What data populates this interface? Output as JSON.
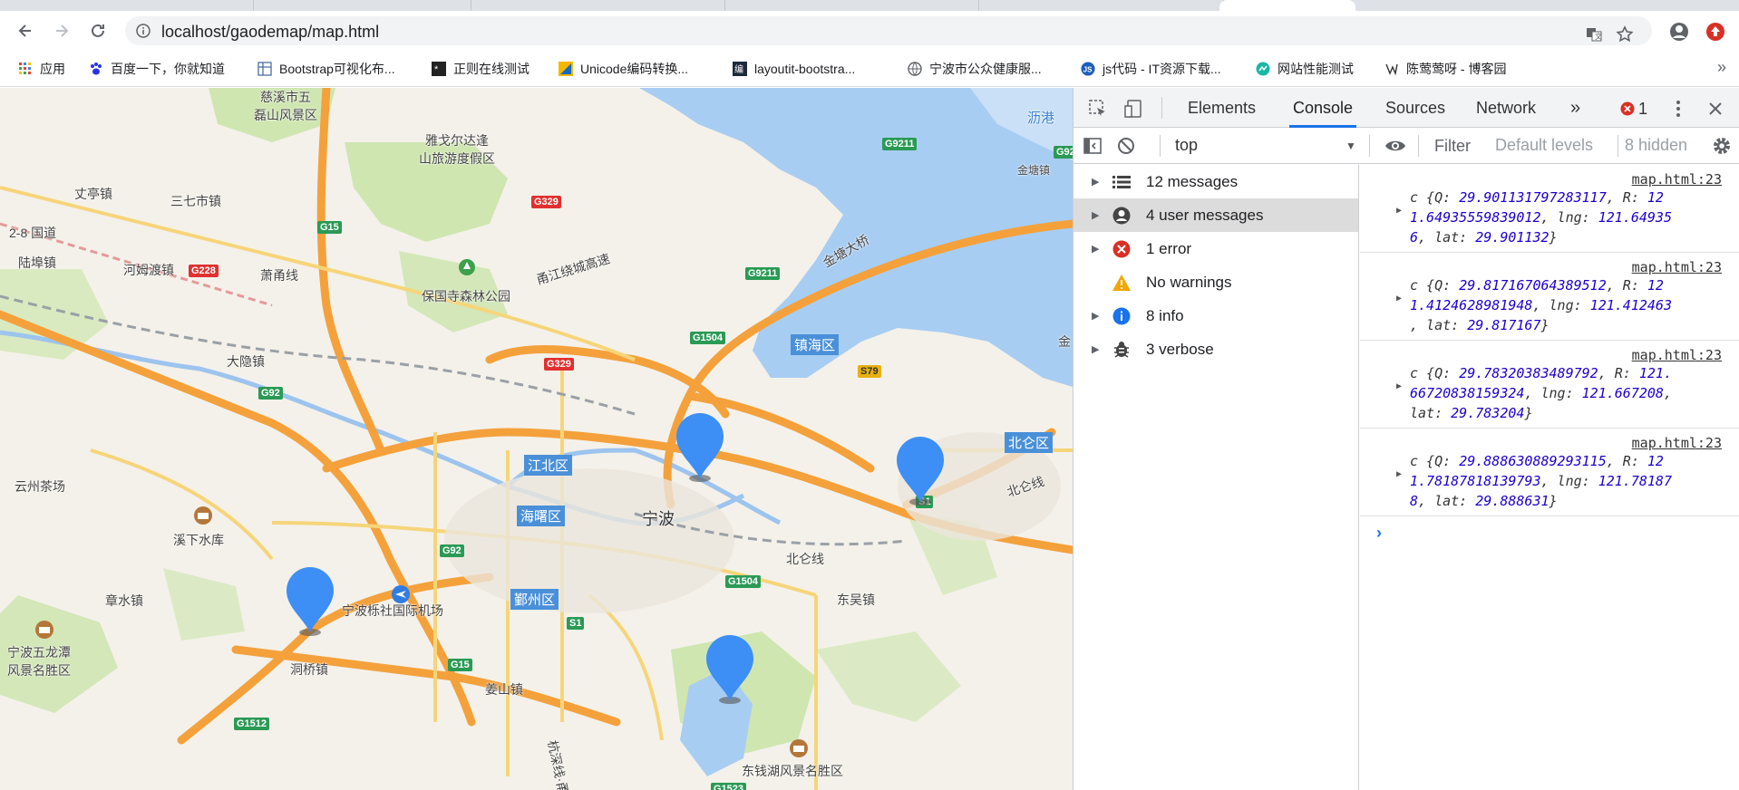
{
  "browser": {
    "url": "localhost/gaodemap/map.html",
    "bookmarks": [
      {
        "label": "应用",
        "icon": "apps-grid-icon"
      },
      {
        "label": "百度一下，你就知道",
        "icon": "baidu-paw-icon"
      },
      {
        "label": "Bootstrap可视化布...",
        "icon": "grid-layout-icon"
      },
      {
        "label": "正则在线测试",
        "icon": "regex-star-icon"
      },
      {
        "label": "Unicode编码转换...",
        "icon": "unicode-icon"
      },
      {
        "label": "layoutit-bootstra...",
        "icon": "editor-icon"
      },
      {
        "label": "宁波市公众健康服...",
        "icon": "globe-icon"
      },
      {
        "label": "js代码 - IT资源下载...",
        "icon": "js-icon"
      },
      {
        "label": "网站性能测试",
        "icon": "speed-icon"
      },
      {
        "label": "陈莺莺呀 - 博客园",
        "icon": "blog-icon"
      }
    ],
    "more_label": "»"
  },
  "map": {
    "places": {
      "cixi": "慈溪市五\n磊山风景区",
      "yage": "雅戈尔达逢\n山旅游度假区",
      "lixiang": "丈亭镇",
      "sanqi": "三七市镇",
      "g28": "2-8 国道",
      "luyu": "陆埠镇",
      "hemu": "河姆渡镇",
      "baoguo": "保国寺森林公园",
      "dayin": "大隐镇",
      "yunzhou": "云州茶场",
      "xixia": "溪下水库",
      "zhangshui": "章水镇",
      "wulong": "宁波五龙潭\n风景名胜区",
      "dongqiao": "洞桥镇",
      "jiangshan": "姜山镇",
      "dongwu": "东吴镇",
      "dongqian": "东钱湖风景名胜区",
      "ningbo": "宁波",
      "airport": "宁波栎社国际机场",
      "jintang": "金塘大桥",
      "jintangzhen": "金塘镇",
      "ligang": "沥港",
      "jin": "金",
      "yongjiang": "甬江绕城高速",
      "xiaoyong": "萧甬线",
      "beilunxian": "北仑线",
      "beilunxian2": "北仑线",
      "yongqian": "杭深线·甬"
    },
    "districts": {
      "jiangbei": "江北区",
      "haishu": "海曙区",
      "yinzhou": "鄞州区",
      "zhenhai": "镇海区",
      "beilun": "北仑区"
    },
    "shields": {
      "g15a": "G15",
      "g15b": "G15",
      "g92a": "G92",
      "g92b": "G92",
      "g228": "G228",
      "g329a": "G329",
      "g329b": "G329",
      "g9211a": "G9211",
      "g9211b": "G9211",
      "g1504a": "G1504",
      "g1504b": "G1504",
      "s79": "S79",
      "s1a": "S1",
      "s1b": "S1",
      "g1512": "G1512",
      "g92c": "G92",
      "g1523": "G1523"
    },
    "markers": [
      {
        "lat": 29.901132,
        "lng": 121.649356
      },
      {
        "lat": 29.817167,
        "lng": 121.412463
      },
      {
        "lat": 29.783204,
        "lng": 121.667208
      },
      {
        "lat": 29.888631,
        "lng": 121.781878
      }
    ],
    "marker_color": "#3d8ef5"
  },
  "devtools": {
    "tabs": [
      "Elements",
      "Console",
      "Sources",
      "Network"
    ],
    "active_tab": "Console",
    "more_tabs": "»",
    "error_count": "1",
    "context": "top",
    "filter_placeholder": "Filter",
    "levels": "Default levels",
    "hidden": "8 hidden",
    "sidebar": [
      {
        "label": "12 messages",
        "icon": "list-icon"
      },
      {
        "label": "4 user messages",
        "icon": "user-icon"
      },
      {
        "label": "1 error",
        "icon": "error-icon"
      },
      {
        "label": "No warnings",
        "icon": "warning-icon"
      },
      {
        "label": "8 info",
        "icon": "info-icon"
      },
      {
        "label": "3 verbose",
        "icon": "bug-icon"
      }
    ],
    "messages": [
      {
        "src": "map.html:23",
        "l1a": "c {Q: ",
        "l1b": "29.901131797283117",
        "l1c": ", R: ",
        "l1d": "12",
        "l2a": "1.64935559839012",
        "l2b": ", lng: ",
        "l2c": "121.64935",
        "l3a": "6",
        "l3b": ", lat: ",
        "l3c": "29.901132",
        "l3d": "}"
      },
      {
        "src": "map.html:23",
        "l1a": "c {Q: ",
        "l1b": "29.817167064389512",
        "l1c": ", R: ",
        "l1d": "12",
        "l2a": "1.4124628981948",
        "l2b": ", lng: ",
        "l2c": "121.412463",
        "l3a": "",
        "l3b": ", lat: ",
        "l3c": "29.817167",
        "l3d": "}"
      },
      {
        "src": "map.html:23",
        "l1a": "c {Q: ",
        "l1b": "29.78320383489792",
        "l1c": ", R: ",
        "l1d": "121.",
        "l2a": "66720838159324",
        "l2b": ", lng: ",
        "l2c": "121.667208",
        "l3a": "",
        "l3b": "lat: ",
        "l3c": "29.783204",
        "l3d": "}"
      },
      {
        "src": "map.html:23",
        "l1a": "c {Q: ",
        "l1b": "29.888630889293115",
        "l1c": ", R: ",
        "l1d": "12",
        "l2a": "1.78187818139793",
        "l2b": ", lng: ",
        "l2c": "121.78187",
        "l3a": "8",
        "l3b": ", lat: ",
        "l3c": "29.888631",
        "l3d": "}"
      }
    ],
    "prompt": "›"
  }
}
